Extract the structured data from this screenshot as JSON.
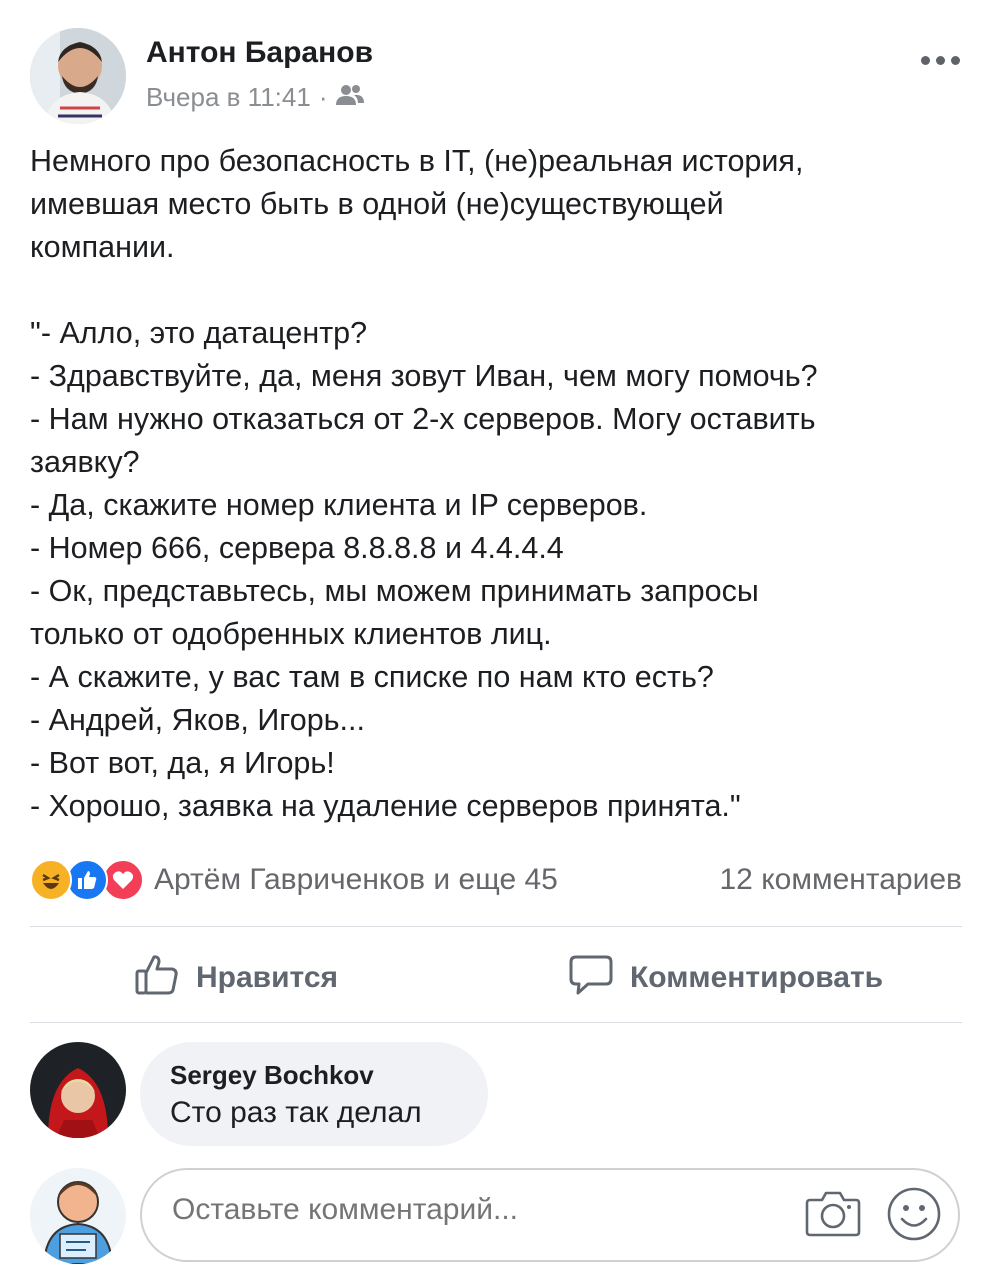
{
  "post": {
    "author": "Антон Баранов",
    "time": "Вчера в 11:41",
    "separator": "·",
    "audience_icon": "friends-icon",
    "paragraph1": [
      "Немного про безопасность в IT, (не)реальная история,",
      "имевшая место быть в одной (не)существующей",
      "компании."
    ],
    "dialog": [
      "\"- Алло, это датацентр?",
      "- Здравствуйте, да, меня зовут Иван, чем могу помочь?",
      "- Нам нужно отказаться от 2-х серверов. Могу оставить",
      "заявку?",
      "- Да, скажите номер клиента и IP серверов.",
      "- Номер 666, сервера 8.8.8.8 и 4.4.4.4",
      "- Ок, представьтесь, мы можем принимать запросы",
      "только от одобренных клиентов лиц.",
      "- А скажите, у вас там в списке по нам кто есть?",
      "- Андрей, Яков, Игорь...",
      "- Вот вот, да, я Игорь!",
      "- Хорошо, заявка на удаление серверов принята.\""
    ]
  },
  "reactions": {
    "icons": [
      "haha-icon",
      "like-icon",
      "love-icon"
    ],
    "colors": {
      "haha": "#f7b125",
      "like": "#1877f2",
      "love": "#f33e58"
    },
    "names": "Артём Гавриченков и еще 45",
    "comments_count": "12 комментариев"
  },
  "actions": {
    "like_label": "Нравится",
    "comment_label": "Комментировать"
  },
  "comment": {
    "author": "Sergey Bochkov",
    "text": "Сто раз так делал"
  },
  "composer": {
    "placeholder": "Оставьте комментарий..."
  }
}
